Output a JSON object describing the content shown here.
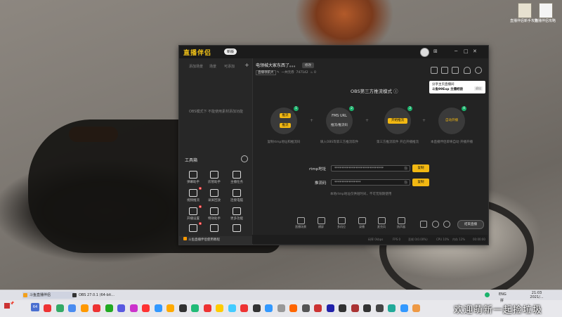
{
  "desktop": {
    "icons": [
      {
        "label": "直播伴侣新手攻略",
        "icon": "document-icon"
      },
      {
        "label": "直播伴侣攻略",
        "icon": "document-icon"
      }
    ]
  },
  "app": {
    "logo": "直播伴侣",
    "version_badge": "新版",
    "window_controls": [
      "⊞",
      "─",
      "□",
      "✕"
    ],
    "sidebar": {
      "tabs": [
        "添加场景",
        "场景",
        "可添加"
      ],
      "add_icon": "plus-icon",
      "empty_text": "OBS模式下 不能使用素材添加功能",
      "tools_title": "工具箱",
      "tools": [
        {
          "label": "弹幕助手",
          "icon": "danmu-icon",
          "new": false
        },
        {
          "label": "房管助手",
          "icon": "admin-icon",
          "new": false
        },
        {
          "label": "主播任务",
          "icon": "task-icon",
          "new": false
        },
        {
          "label": "视频推流",
          "icon": "video-icon",
          "new": true
        },
        {
          "label": "录屏回放",
          "icon": "download-icon",
          "new": false
        },
        {
          "label": "连接电脑",
          "icon": "screen-icon",
          "new": false
        },
        {
          "label": "开播设置",
          "icon": "upload-icon",
          "new": true
        },
        {
          "label": "特效助手",
          "icon": "effect-icon",
          "new": false
        },
        {
          "label": "更多功能",
          "icon": "more-icon",
          "new": false
        },
        {
          "label": "",
          "icon": "gift-icon",
          "new": true
        },
        {
          "label": "",
          "icon": "download-icon",
          "new": false
        },
        {
          "label": "",
          "icon": "bag-icon",
          "new": false
        }
      ],
      "notice": "斗鱼直播伴侣使用教程"
    },
    "room": {
      "title": "电领械大家东西了。。。",
      "tag": "修改",
      "category": "直播领航大",
      "income": "一共元券",
      "viewers": "747142",
      "likes": "0"
    },
    "tooltip": {
      "line1": "分享主页直播间",
      "line2": "斗鱼99Exp 主播经验",
      "action": "退出"
    },
    "obs_mode": {
      "title": "OBS第三方推流模式",
      "steps": [
        {
          "num": "1",
          "pills": [
            "推流",
            "推流"
          ],
          "desc": "复制rtmp地址和推流码"
        },
        {
          "num": "2",
          "top": "FMS URL",
          "bottom": "推流/推流码",
          "desc": "填入OBS等第三方推流软件"
        },
        {
          "num": "3",
          "pill": "开始推流",
          "desc": "第三方推流软件 开启开播推流"
        },
        {
          "num": "4",
          "pill": "自动开播",
          "desc": "本直播伴侣即将自动 开播开播"
        }
      ],
      "rtmp_label": "rtmp地址",
      "rtmp_value": "****************************",
      "key_label": "推流码",
      "key_value": "***************",
      "copy_label": "复制",
      "eye_label": "隐",
      "hint": "本地rtmp地址仅供短时间，不可无限期使用"
    },
    "bottom_bar": [
      {
        "label": "直播场景",
        "icon": "scene-icon"
      },
      {
        "label": "横屏",
        "icon": "rotate-icon"
      },
      {
        "label": "多机位",
        "icon": "camera-icon"
      },
      {
        "label": "录播",
        "icon": "record-icon"
      },
      {
        "label": "麦克风",
        "icon": "mic-icon"
      },
      {
        "label": "扬声器",
        "icon": "speaker-icon"
      }
    ],
    "go_live": "结束直播",
    "status": [
      "码率 0kbps",
      "FPS 0",
      "丢帧 0(0.00%)",
      "CPU 10%",
      "内存 12%",
      "00:00:00"
    ]
  },
  "taskbar": {
    "apps": [
      {
        "label": "斗鱼直播伴侣",
        "color": "#f2a01c",
        "active": true
      },
      {
        "label": "OBS 27.0.1 (64-bit...",
        "color": "#333333",
        "active": false
      }
    ],
    "pinned_colors": [
      "#e33",
      "#3a6",
      "#4a8cf0",
      "#f90",
      "#e33",
      "#2a2",
      "#5a5ae0",
      "#c3c",
      "#f33",
      "#39f",
      "#fa0",
      "#333",
      "#2b7",
      "#e33",
      "#fc0",
      "#4cf",
      "#e33",
      "#333",
      "#39f",
      "#999",
      "#f60",
      "#555",
      "#c33",
      "#22a",
      "#333",
      "#a33",
      "#333",
      "#444",
      "#2a9",
      "#39f",
      "#e94"
    ],
    "tray": [
      "ENG",
      "拼"
    ],
    "time": "21:03",
    "date": "2021/..."
  },
  "overlay_text": "欢迎萌新一起捡垃圾"
}
